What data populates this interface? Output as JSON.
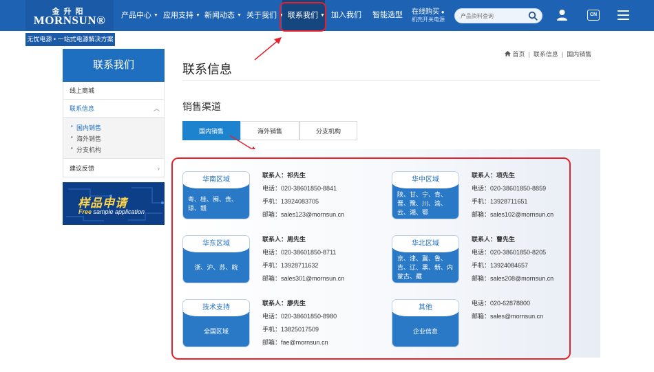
{
  "header": {
    "logo_cn": "金升阳",
    "logo_en": "MORNSUN®",
    "nav": [
      {
        "label": "产品中心",
        "caret": true
      },
      {
        "label": "应用支持",
        "caret": true
      },
      {
        "label": "新闻动态",
        "caret": true
      },
      {
        "label": "关于我们",
        "caret": true
      },
      {
        "label": "联系我们",
        "caret": true,
        "active": true
      },
      {
        "label": "加入我们",
        "caret": false
      },
      {
        "label": "智能选型",
        "caret": false
      }
    ],
    "online": {
      "title": "在线购买",
      "subtitle": "机壳开关电源"
    },
    "search_placeholder": "产品资料查询",
    "lang": "CN",
    "slogan": "无忧电源 • 一站式电源解决方案"
  },
  "sidebar": {
    "title": "联系我们",
    "items": [
      {
        "label": "线上商城"
      },
      {
        "label": "联系信息",
        "expanded": true
      },
      {
        "label": "建议反馈"
      }
    ],
    "subitems": [
      {
        "label": "国内销售",
        "active": true
      },
      {
        "label": "海外销售"
      },
      {
        "label": "分支机构"
      }
    ],
    "banner": {
      "title": "样品申请",
      "subtitle_a": "Free",
      "subtitle_b": " sample application"
    }
  },
  "breadcrumb": [
    "首页",
    "联系信息",
    "国内销售"
  ],
  "page_title": "联系信息",
  "section_title": "销售渠道",
  "tabs": [
    {
      "label": "国内销售",
      "active": true
    },
    {
      "label": "海外销售"
    },
    {
      "label": "分支机构"
    }
  ],
  "regions": [
    {
      "title": "华南区域",
      "provinces": "粤、桂、闽、贵、琼、赣",
      "contact": "联系人：祁先生",
      "phone": "电话：020-38601850-8841",
      "mobile": "手机：13924083705",
      "email": "邮箱：sales123@mornsun.cn"
    },
    {
      "title": "华中区域",
      "provinces": "陕、甘、宁、青、晋、豫、川、渝、云、湘、鄂",
      "contact": "联系人：项先生",
      "phone": "电话：020-38601850-8859",
      "mobile": "手机：13928711651",
      "email": "邮箱：sales102@mornsun.cn"
    },
    {
      "title": "华东区域",
      "provinces": "浙、沪、苏、皖",
      "contact": "联系人：周先生",
      "phone": "电话：020-38601850-8711",
      "mobile": "手机：13928711632",
      "email": "邮箱：sales301@mornsun.cn"
    },
    {
      "title": "华北区域",
      "provinces": "京、津、冀、鲁、吉、辽、黑、新、内蒙古、藏",
      "contact": "联系人：曹先生",
      "phone": "电话：020-38601850-8205",
      "mobile": "手机：13924084657",
      "email": "邮箱：sales208@mornsun.cn"
    },
    {
      "title": "技术支持",
      "provinces": "全国区域",
      "contact": "联系人：廖先生",
      "phone": "电话：020-38601850-8980",
      "mobile": "手机：13825017509",
      "email": "邮箱：fae@mornsun.cn"
    },
    {
      "title": "其他",
      "provinces": "企业信息",
      "phone": "电话：020-62878800",
      "email": "邮箱：sales@mornsun.cn"
    }
  ],
  "colors": {
    "brand_blue": "#1e63b3",
    "active_tab": "#1e83cf",
    "highlight_red": "#e8202a"
  }
}
